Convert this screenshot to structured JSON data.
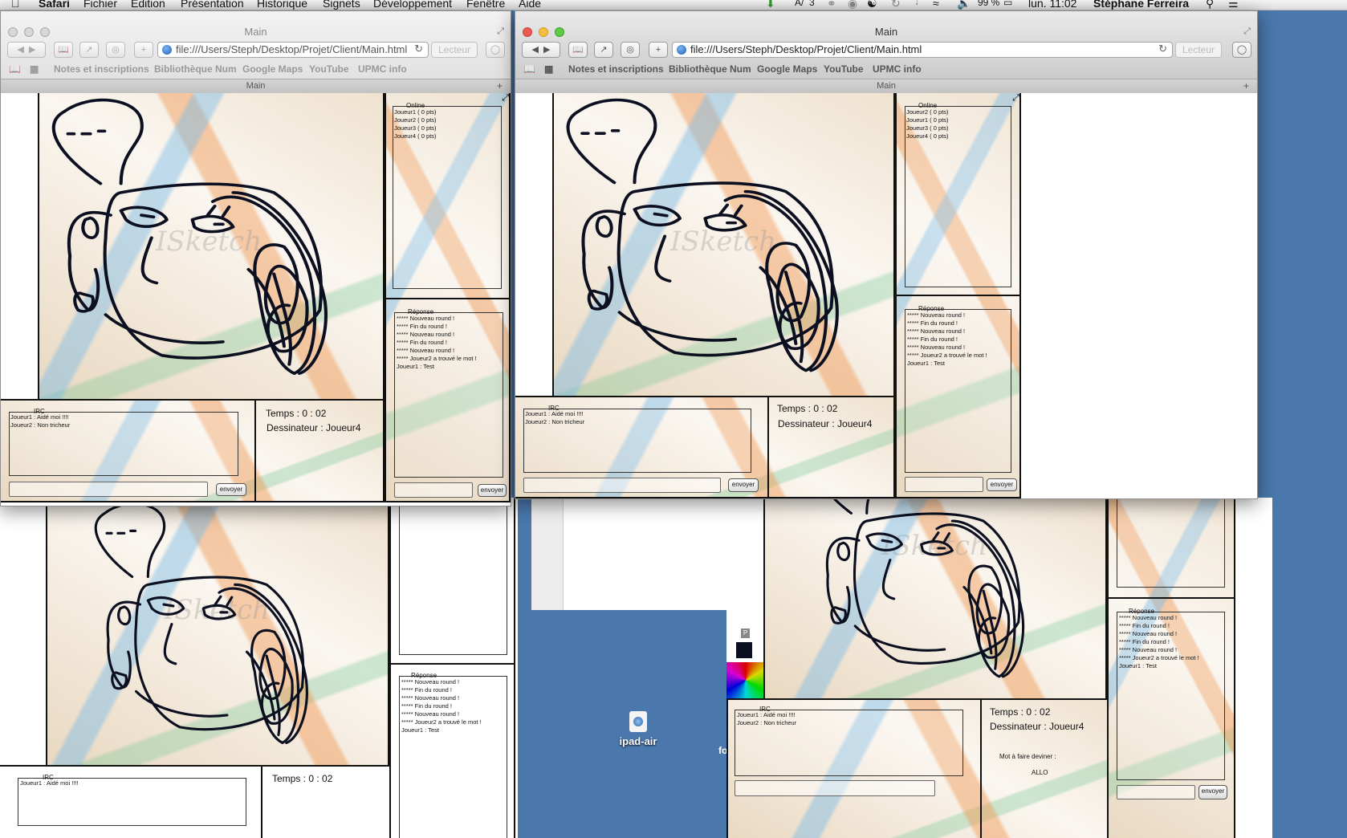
{
  "menubar": {
    "app": "Safari",
    "items": [
      "Fichier",
      "Edition",
      "Présentation",
      "Historique",
      "Signets",
      "Développement",
      "Fenêtre",
      "Aide"
    ],
    "battery": "99 %",
    "clock": "lun. 11:02",
    "user": "Stéphane Ferreira",
    "badge": "3"
  },
  "browser": {
    "window_title": "Main",
    "url": "file:///Users/Steph/Desktop/Projet/Client/Main.html",
    "reader_label": "Lecteur",
    "tab_title": "Main",
    "bookmarks": [
      "Notes et inscriptions",
      "Bibliothèque Num",
      "Google Maps",
      "YouTube",
      "UPMC info"
    ]
  },
  "game": {
    "watermark": "ISketch",
    "online_legend": "Online",
    "response_legend": "Réponse",
    "irc_legend": "IRC",
    "send_label": "envoyer",
    "time_label": "Temps : 0 : 02",
    "drawer_label": "Dessinateur : Joueur4",
    "word_label": "Mot à faire deviner :",
    "word_value": "ALLO",
    "players_left": [
      "Joueur1 ( 0 pts)",
      "Joueur2 ( 0 pts)",
      "Joueur3 ( 0 pts)",
      "Joueur4 ( 0 pts)"
    ],
    "players_right": [
      "Joueur2 ( 0 pts)",
      "Joueur1 ( 0 pts)",
      "Joueur3 ( 0 pts)",
      "Joueur4 ( 0 pts)"
    ],
    "responses": [
      "***** Nouveau round !",
      "***** Fin du round !",
      "***** Nouveau round !",
      "***** Fin du round !",
      "***** Nouveau round !",
      "***** Joueur2 a trouvé le mot !",
      "Joueur1 : Test"
    ],
    "irc": [
      "Joueur1 : Aidé moi !!!!",
      "Joueur2 : Non tricheur"
    ],
    "irc_partial": "Joueur1 : Aidé moi !!!!",
    "palette_p": "P"
  },
  "desktop": {
    "icon_label": "ipad-air",
    "edge_text": "fo"
  },
  "colors": {
    "desktop": "#4a78ad",
    "stroke": "#0b0f1f",
    "light_red": "#ee5a52",
    "light_yellow": "#f5be3f",
    "light_green": "#5fcb48"
  }
}
